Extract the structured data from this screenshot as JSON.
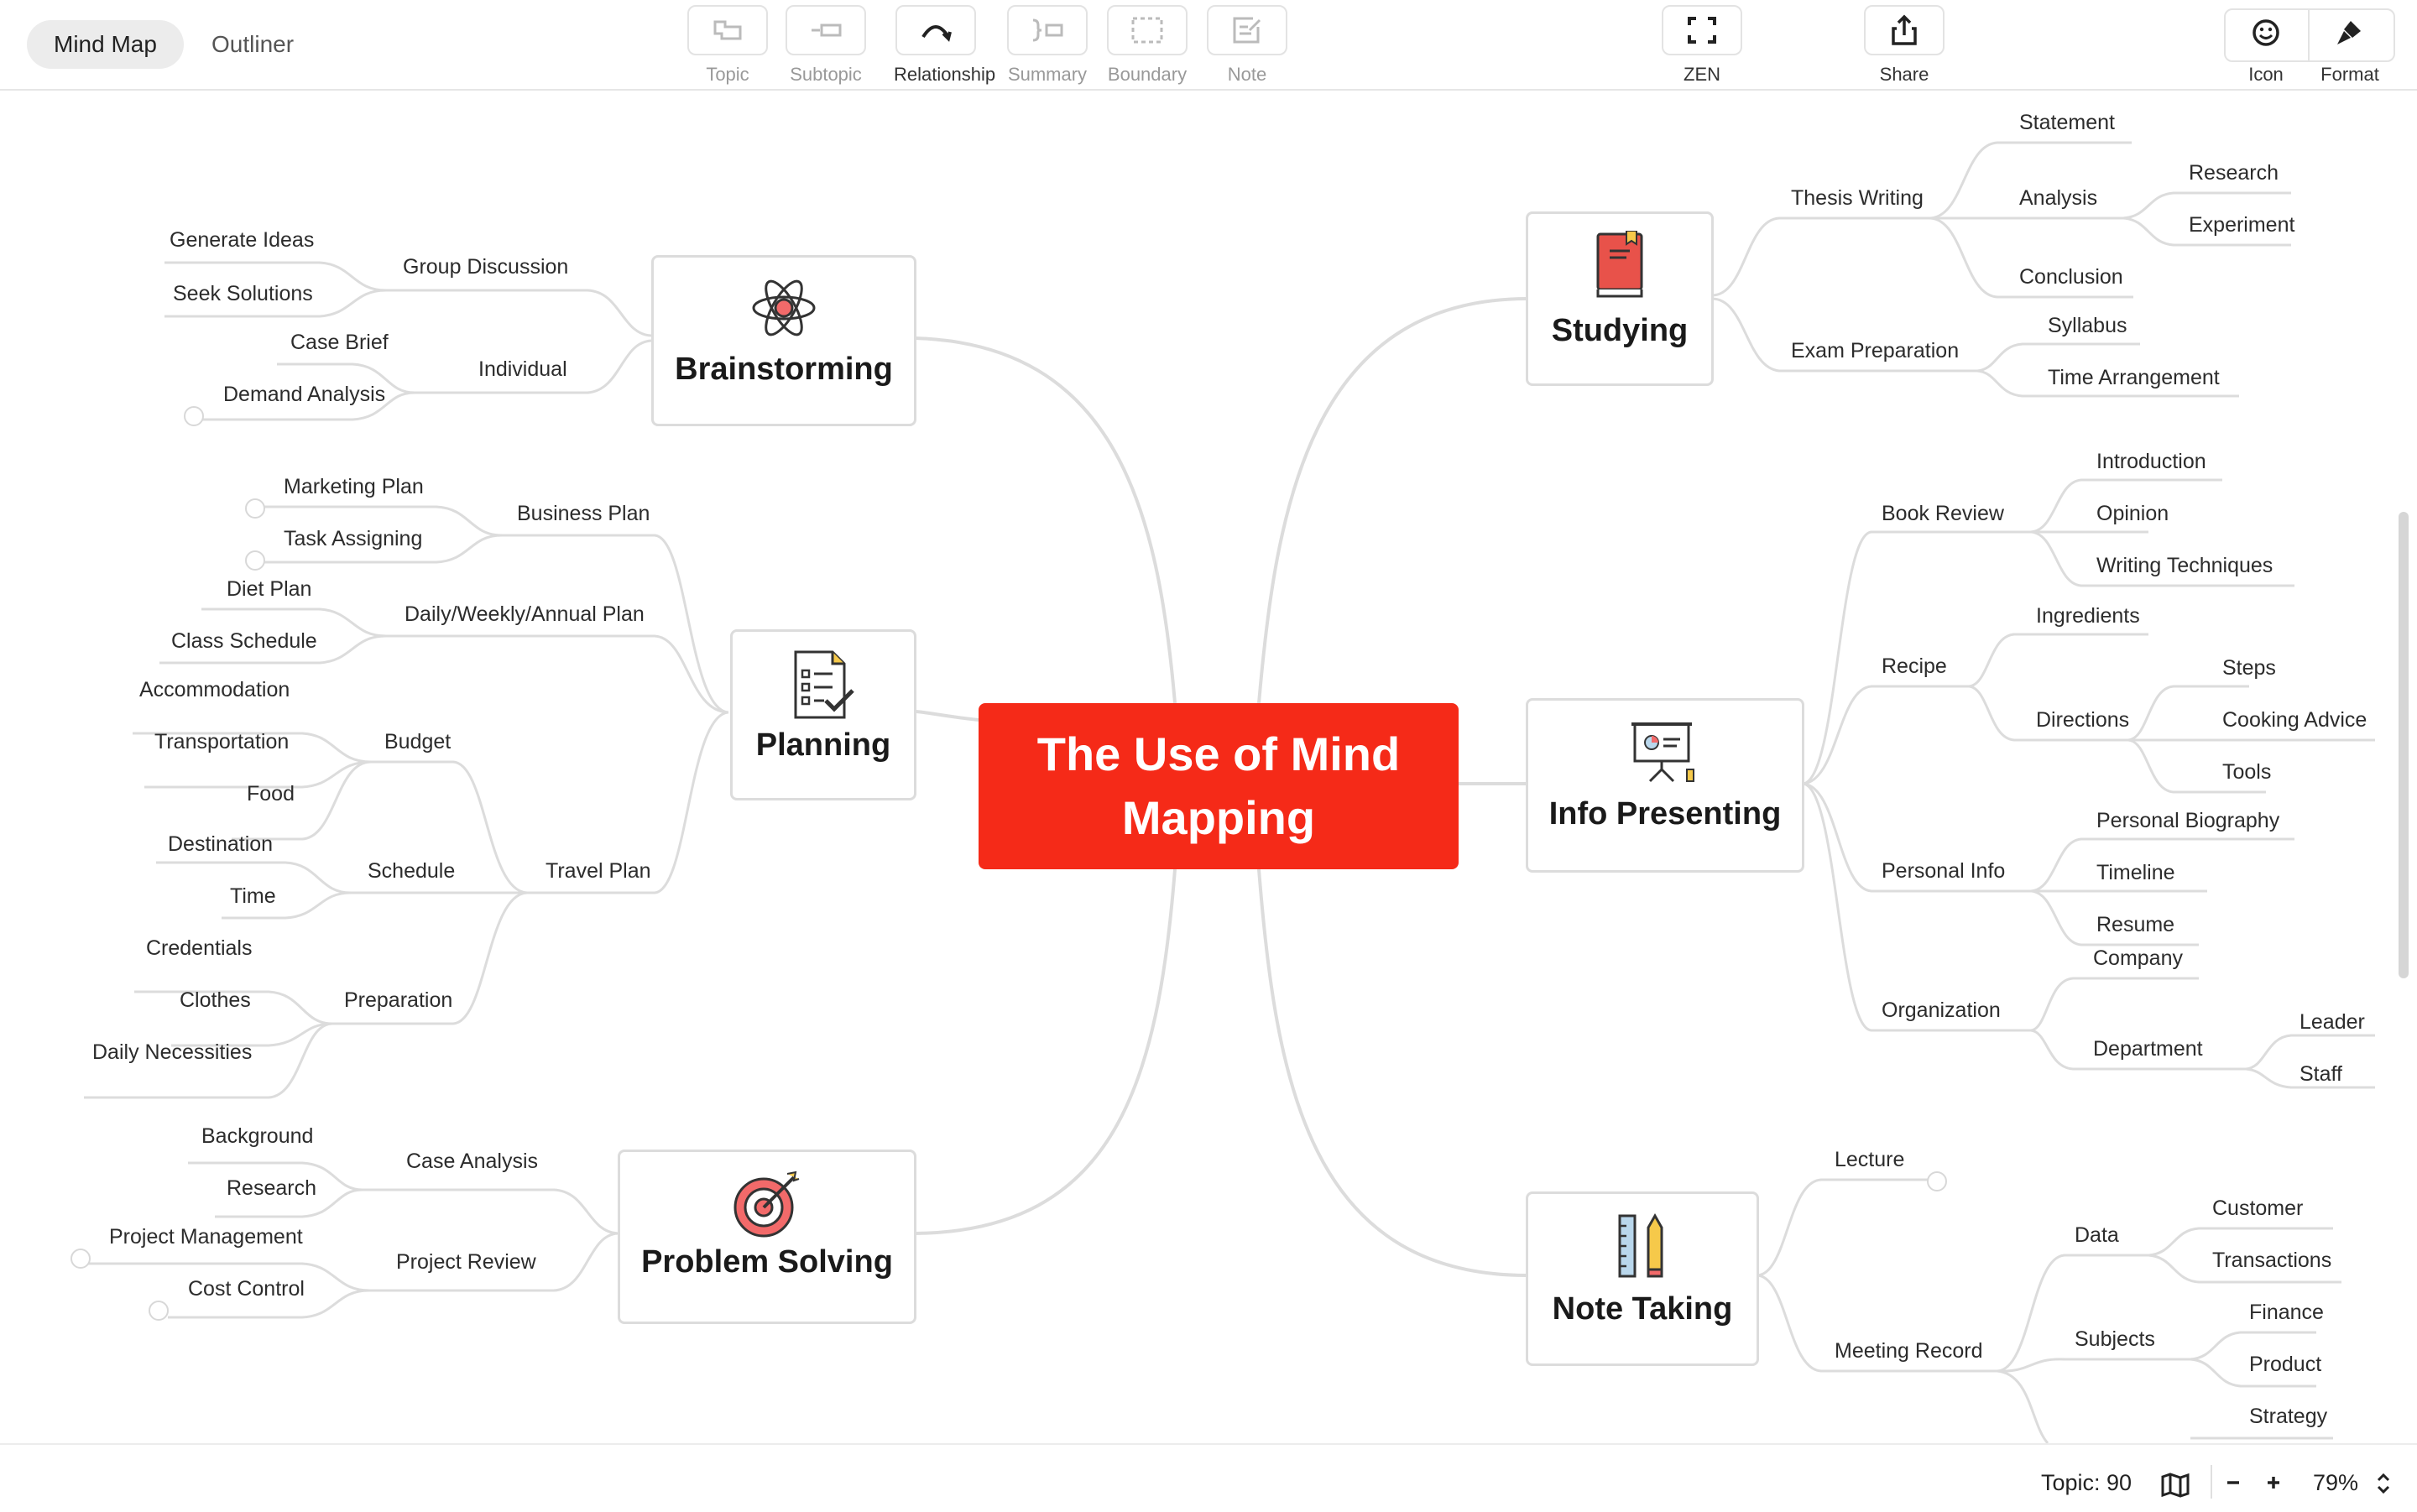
{
  "toolbar": {
    "tabs": [
      {
        "label": "Mind Map",
        "active": true
      },
      {
        "label": "Outliner",
        "active": false
      }
    ],
    "tools": [
      {
        "label": "Topic",
        "icon": "topic-icon",
        "enabled": false
      },
      {
        "label": "Subtopic",
        "icon": "subtopic-icon",
        "enabled": false
      },
      {
        "label": "Relationship",
        "icon": "relationship-icon",
        "enabled": true
      },
      {
        "label": "Summary",
        "icon": "summary-icon",
        "enabled": false
      },
      {
        "label": "Boundary",
        "icon": "boundary-icon",
        "enabled": false
      },
      {
        "label": "Note",
        "icon": "note-icon",
        "enabled": false
      }
    ],
    "zen_label": "ZEN",
    "share_label": "Share",
    "icon_label": "Icon",
    "format_label": "Format"
  },
  "central_topic": "The Use of Mind Mapping",
  "branches": {
    "brainstorming": {
      "label": "Brainstorming",
      "icon": "atom-icon"
    },
    "planning": {
      "label": "Planning",
      "icon": "checklist-icon"
    },
    "problem_solving": {
      "label": "Problem Solving",
      "icon": "target-icon"
    },
    "studying": {
      "label": "Studying",
      "icon": "book-icon"
    },
    "info_presenting": {
      "label": "Info Presenting",
      "icon": "presentation-board-icon"
    },
    "note_taking": {
      "label": "Note Taking",
      "icon": "ruler-pencil-icon"
    }
  },
  "topics": {
    "group_discussion": "Group Discussion",
    "generate_ideas": "Generate Ideas",
    "seek_solutions": "Seek Solutions",
    "individual": "Individual",
    "case_brief": "Case Brief",
    "demand_analysis": "Demand Analysis",
    "business_plan": "Business Plan",
    "marketing_plan": "Marketing Plan",
    "task_assigning": "Task Assigning",
    "daily_plan": "Daily/Weekly/Annual Plan",
    "diet_plan": "Diet Plan",
    "class_schedule": "Class Schedule",
    "travel_plan": "Travel Plan",
    "budget": "Budget",
    "accommodation": "Accommodation",
    "transportation": "Transportation",
    "food": "Food",
    "schedule": "Schedule",
    "destination": "Destination",
    "time": "Time",
    "preparation": "Preparation",
    "credentials": "Credentials",
    "clothes": "Clothes",
    "daily_necessities": "Daily Necessities",
    "case_analysis": "Case Analysis",
    "background": "Background",
    "research_ps": "Research",
    "project_review": "Project Review",
    "project_management": "Project Management",
    "cost_control": "Cost Control",
    "thesis_writing": "Thesis Writing",
    "statement": "Statement",
    "analysis": "Analysis",
    "research": "Research",
    "experiment": "Experiment",
    "conclusion": "Conclusion",
    "exam_preparation": "Exam Preparation",
    "syllabus": "Syllabus",
    "time_arrangement": "Time Arrangement",
    "book_review": "Book Review",
    "introduction": "Introduction",
    "opinion": "Opinion",
    "writing_techniques": "Writing Techniques",
    "recipe": "Recipe",
    "ingredients": "Ingredients",
    "directions": "Directions",
    "steps": "Steps",
    "cooking_advice": "Cooking Advice",
    "tools": "Tools",
    "personal_info": "Personal Info",
    "personal_biography": "Personal Biography",
    "timeline": "Timeline",
    "resume": "Resume",
    "organization": "Organization",
    "company": "Company",
    "department": "Department",
    "leader": "Leader",
    "staff": "Staff",
    "lecture": "Lecture",
    "meeting_record": "Meeting Record",
    "data": "Data",
    "customer": "Customer",
    "transactions": "Transactions",
    "subjects": "Subjects",
    "finance": "Finance",
    "product": "Product",
    "strategy": "Strategy"
  },
  "status": {
    "topic_count": "Topic: 90",
    "zoom": "79%"
  },
  "colors": {
    "central": "#f52a18",
    "link": "#dcdcdc"
  }
}
